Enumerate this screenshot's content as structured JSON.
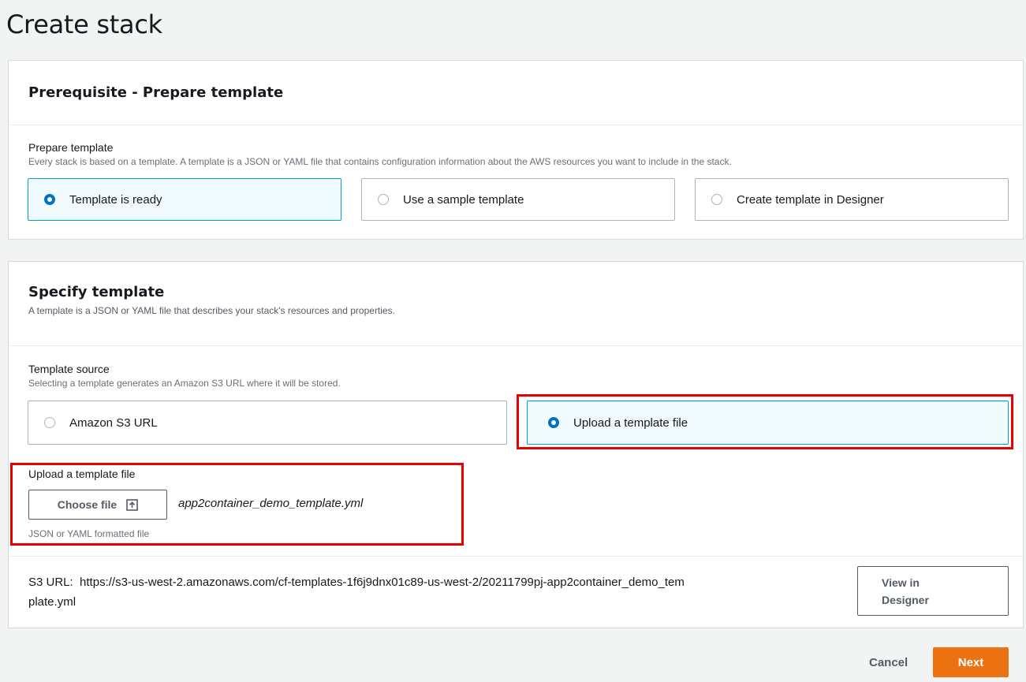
{
  "page": {
    "title": "Create stack"
  },
  "prerequisite": {
    "heading": "Prerequisite - Prepare template",
    "field_label": "Prepare template",
    "field_desc": "Every stack is based on a template. A template is a JSON or YAML file that contains configuration information about the AWS resources you want to include in the stack.",
    "options": [
      {
        "label": "Template is ready",
        "selected": true
      },
      {
        "label": "Use a sample template",
        "selected": false
      },
      {
        "label": "Create template in Designer",
        "selected": false
      }
    ]
  },
  "specify": {
    "heading": "Specify template",
    "desc": "A template is a JSON or YAML file that describes your stack's resources and properties.",
    "source_label": "Template source",
    "source_desc": "Selecting a template generates an Amazon S3 URL where it will be stored.",
    "sources": [
      {
        "label": "Amazon S3 URL",
        "selected": false
      },
      {
        "label": "Upload a template file",
        "selected": true
      }
    ],
    "upload_label": "Upload a template file",
    "choose_file_label": "Choose file",
    "file_name": "app2container_demo_template.yml",
    "upload_hint": "JSON or YAML formatted file",
    "s3_url_label": "S3 URL:",
    "s3_url_value": "https://s3-us-west-2.amazonaws.com/cf-templates-1f6j9dnx01c89-us-west-2/20211799pj-app2container_demo_tem",
    "s3_url_value_cont": "plate.yml",
    "view_designer_line1": "View in",
    "view_designer_line2": "Designer"
  },
  "footer": {
    "cancel_label": "Cancel",
    "next_label": "Next"
  },
  "colors": {
    "accent": "#ec7211",
    "selected_border": "#00a1c9",
    "radio": "#0073bb",
    "highlight": "#e60000"
  },
  "icons": {
    "upload": "upload-icon"
  }
}
